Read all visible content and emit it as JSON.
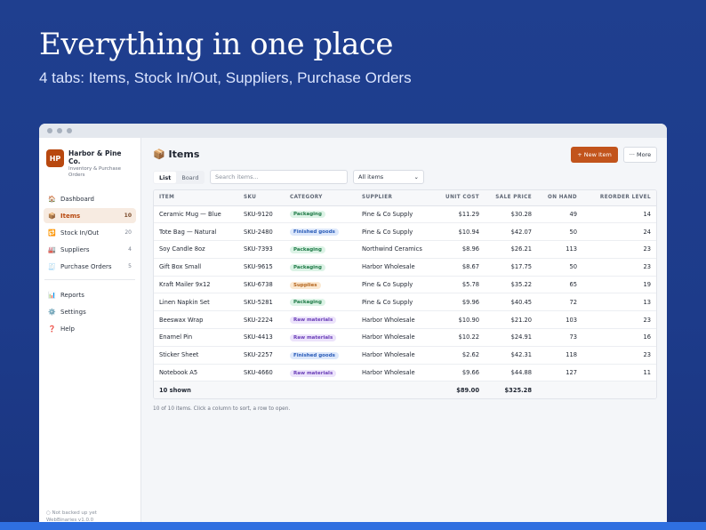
{
  "hero": {
    "title": "Everything in one place",
    "subtitle": "4 tabs: Items, Stock In/Out, Suppliers, Purchase Orders"
  },
  "brand": {
    "logo": "HP",
    "name": "Harbor & Pine Co.",
    "tagline": "Inventory & Purchase Orders"
  },
  "nav": {
    "main": [
      {
        "label": "Dashboard",
        "icon": "home-icon",
        "glyph": "🏠",
        "count": ""
      },
      {
        "label": "Items",
        "icon": "box-icon",
        "glyph": "📦",
        "count": "10",
        "active": true
      },
      {
        "label": "Stock In/Out",
        "icon": "arrows-icon",
        "glyph": "🔁",
        "count": "20"
      },
      {
        "label": "Suppliers",
        "icon": "factory-icon",
        "glyph": "🏭",
        "count": "4"
      },
      {
        "label": "Purchase Orders",
        "icon": "receipt-icon",
        "glyph": "🧾",
        "count": "5"
      }
    ],
    "secondary": [
      {
        "label": "Reports",
        "icon": "chart-icon",
        "glyph": "📊"
      },
      {
        "label": "Settings",
        "icon": "gear-icon",
        "glyph": "⚙️"
      },
      {
        "label": "Help",
        "icon": "question-icon",
        "glyph": "❓"
      }
    ]
  },
  "footer": {
    "status": "○ Not backed up yet",
    "version": "WebBinaries v1.0.0"
  },
  "page": {
    "title": "Items",
    "title_icon": "📦",
    "new_button": "+ New Item",
    "more_button": "··· More",
    "view_tabs": [
      "List",
      "Board"
    ],
    "search_placeholder": "Search items...",
    "filter_value": "All items"
  },
  "table": {
    "columns": [
      "ITEM",
      "SKU",
      "CATEGORY",
      "SUPPLIER",
      "UNIT COST",
      "SALE PRICE",
      "ON HAND",
      "REORDER LEVEL"
    ],
    "rows": [
      {
        "item": "Ceramic Mug — Blue",
        "sku": "SKU-9120",
        "category": "Packaging",
        "supplier": "Pine & Co Supply",
        "unit_cost": "$11.29",
        "sale_price": "$30.28",
        "on_hand": "49",
        "reorder": "14"
      },
      {
        "item": "Tote Bag — Natural",
        "sku": "SKU-2480",
        "category": "Finished goods",
        "supplier": "Pine & Co Supply",
        "unit_cost": "$10.94",
        "sale_price": "$42.07",
        "on_hand": "50",
        "reorder": "24"
      },
      {
        "item": "Soy Candle 8oz",
        "sku": "SKU-7393",
        "category": "Packaging",
        "supplier": "Northwind Ceramics",
        "unit_cost": "$8.96",
        "sale_price": "$26.21",
        "on_hand": "113",
        "reorder": "23"
      },
      {
        "item": "Gift Box Small",
        "sku": "SKU-9615",
        "category": "Packaging",
        "supplier": "Harbor Wholesale",
        "unit_cost": "$8.67",
        "sale_price": "$17.75",
        "on_hand": "50",
        "reorder": "23"
      },
      {
        "item": "Kraft Mailer 9x12",
        "sku": "SKU-6738",
        "category": "Supplies",
        "supplier": "Pine & Co Supply",
        "unit_cost": "$5.78",
        "sale_price": "$35.22",
        "on_hand": "65",
        "reorder": "19"
      },
      {
        "item": "Linen Napkin Set",
        "sku": "SKU-5281",
        "category": "Packaging",
        "supplier": "Pine & Co Supply",
        "unit_cost": "$9.96",
        "sale_price": "$40.45",
        "on_hand": "72",
        "reorder": "13"
      },
      {
        "item": "Beeswax Wrap",
        "sku": "SKU-2224",
        "category": "Raw materials",
        "supplier": "Harbor Wholesale",
        "unit_cost": "$10.90",
        "sale_price": "$21.20",
        "on_hand": "103",
        "reorder": "23"
      },
      {
        "item": "Enamel Pin",
        "sku": "SKU-4413",
        "category": "Raw materials",
        "supplier": "Harbor Wholesale",
        "unit_cost": "$10.22",
        "sale_price": "$24.91",
        "on_hand": "73",
        "reorder": "16"
      },
      {
        "item": "Sticker Sheet",
        "sku": "SKU-2257",
        "category": "Finished goods",
        "supplier": "Harbor Wholesale",
        "unit_cost": "$2.62",
        "sale_price": "$42.31",
        "on_hand": "118",
        "reorder": "23"
      },
      {
        "item": "Notebook A5",
        "sku": "SKU-4660",
        "category": "Raw materials",
        "supplier": "Harbor Wholesale",
        "unit_cost": "$9.66",
        "sale_price": "$44.88",
        "on_hand": "127",
        "reorder": "11"
      }
    ],
    "footer": {
      "label": "10 shown",
      "unit_cost_total": "$89.00",
      "sale_price_total": "$325.28"
    },
    "note": "10 of 10 items. Click a column to sort, a row to open."
  },
  "colors": {
    "accent": "#c2541c",
    "background": "#1f3f8f",
    "packaging": "#1f7a47",
    "finished_goods": "#2b5cb8",
    "supplies": "#b5651d",
    "raw_materials": "#6b3fb8"
  }
}
